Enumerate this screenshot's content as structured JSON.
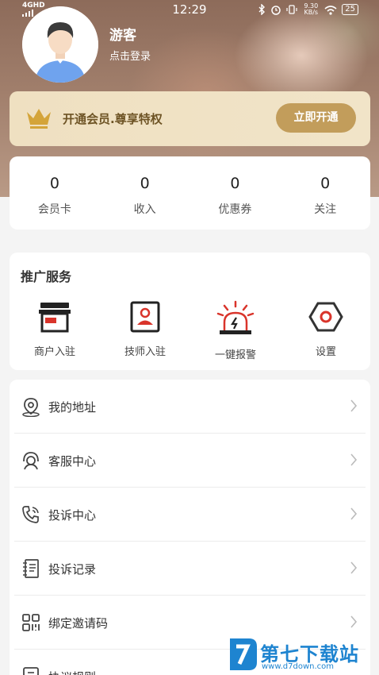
{
  "status_bar": {
    "network": "4GHD",
    "time": "12:29",
    "speed": "9.30 KB/s",
    "battery": "25"
  },
  "profile": {
    "name": "游客",
    "login_hint": "点击登录"
  },
  "vip": {
    "text": "开通会员.尊享特权",
    "button": "立即开通",
    "accent": "#c29d5b"
  },
  "stats": [
    {
      "value": "0",
      "label": "会员卡"
    },
    {
      "value": "0",
      "label": "收入"
    },
    {
      "value": "0",
      "label": "优惠券"
    },
    {
      "value": "0",
      "label": "关注"
    }
  ],
  "promotion": {
    "title": "推广服务",
    "services": [
      {
        "label": "商户入驻",
        "icon": "storefront-icon"
      },
      {
        "label": "技师入驻",
        "icon": "id-card-icon"
      },
      {
        "label": "一键报警",
        "icon": "alarm-siren-icon"
      },
      {
        "label": "设置",
        "icon": "hexagon-settings-icon"
      }
    ]
  },
  "menu": [
    {
      "label": "我的地址",
      "icon": "location-pin-icon"
    },
    {
      "label": "客服中心",
      "icon": "headset-icon"
    },
    {
      "label": "投诉中心",
      "icon": "phone-icon"
    },
    {
      "label": "投诉记录",
      "icon": "notebook-icon"
    },
    {
      "label": "绑定邀请码",
      "icon": "qr-grid-icon"
    },
    {
      "label": "协议规则",
      "icon": "document-icon"
    }
  ],
  "watermark": {
    "main": "第七下载站",
    "sub": "www.d7down.com"
  },
  "colors": {
    "brand_red": "#d9342b",
    "watermark_blue": "#1e84d0"
  }
}
